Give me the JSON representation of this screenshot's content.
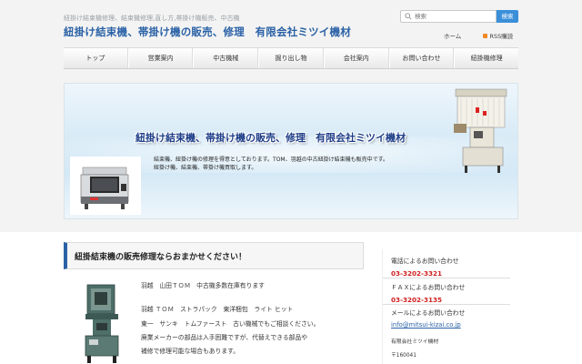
{
  "header": {
    "tagline": "紐掛け結束機修理、結束機修理,直し方,帯掛け機販売、中古機",
    "site_title": "紐掛け結束機、帯掛け機の販売、修理　有限会社ミツイ機材",
    "search_placeholder": "検索",
    "search_button": "検索",
    "links": [
      "ホーム",
      "RSS購読"
    ]
  },
  "nav": {
    "items": [
      "トップ",
      "営業案内",
      "中古機械",
      "掘り出し物",
      "会社案内",
      "お問い合わせ",
      "紐掛機修理"
    ]
  },
  "banner": {
    "title": "紐掛け結束機、帯掛け機の販売、修理　有限会社ミツイ機材",
    "lines": [
      "結束機、紐掛け機の修理を得意としております。TOM、羽越の中古紐掛け結束機も販売中です。",
      "紐掛け機、結束機、帯掛け機買取します。"
    ]
  },
  "content": {
    "heading": "紐掛結束機の販売修理ならおまかせください！",
    "lines": [
      "羽越　山田ＴＯＭ　中古機多数在庫有ります",
      "羽越 ＴＯＭ　ストラパック　東洋梱包　ライト ヒット",
      "東一　サンキ　トムファースト　古い機械でもご相談ください。",
      "廃業メーカーの部品は入手困難ですが、代替えできる部品や",
      "補修で修理可能な場合もあります。"
    ]
  },
  "sidebar": {
    "phone_label": "電話によるお問い合わせ",
    "phone": "03-3202-3321",
    "fax_label": "ＦＡＸによるお問い合わせ",
    "fax": "03-3202-3135",
    "mail_label": "メールによるお問い合わせ",
    "email": "info@mitsui-kizai.co.jp",
    "company": "有限会社ミツイ機材",
    "postal": "〒160041"
  },
  "colors": {
    "accent": "#2b62a6",
    "search_button": "#3b8fd9",
    "phone_red": "#d02020"
  }
}
